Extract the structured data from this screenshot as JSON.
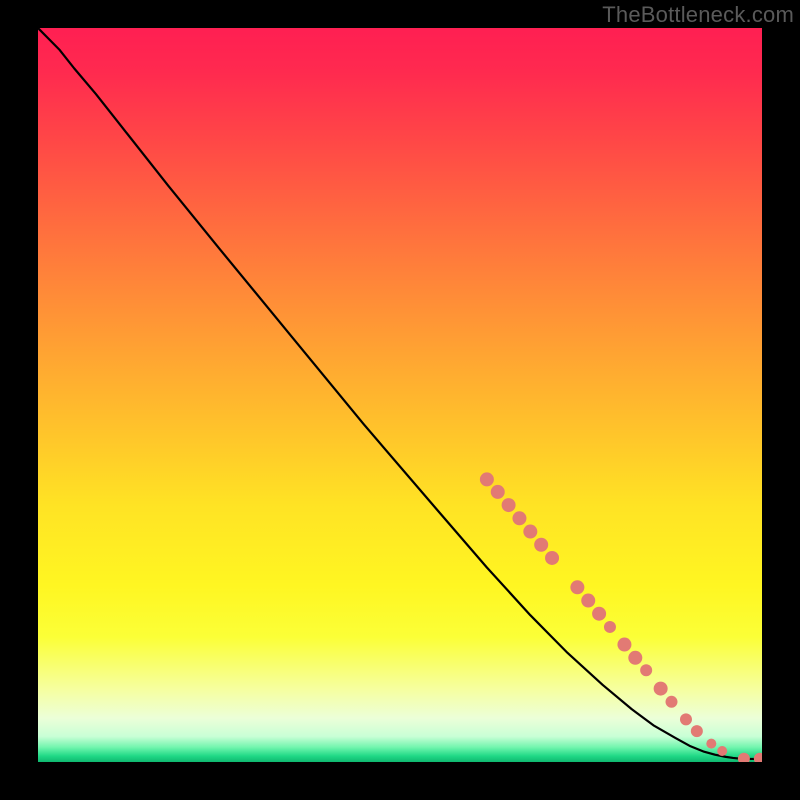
{
  "watermark": "TheBottleneck.com",
  "colors": {
    "frame": "#000000",
    "watermark_text": "#5a5a5a",
    "curve": "#000000",
    "marker_fill": "#e27a74",
    "marker_stroke": "#d46b64",
    "gradient_stops": [
      {
        "offset": 0.0,
        "color": "#ff1f52"
      },
      {
        "offset": 0.06,
        "color": "#ff2a4f"
      },
      {
        "offset": 0.15,
        "color": "#ff4647"
      },
      {
        "offset": 0.26,
        "color": "#ff6a3f"
      },
      {
        "offset": 0.36,
        "color": "#ff8a38"
      },
      {
        "offset": 0.46,
        "color": "#ffa931"
      },
      {
        "offset": 0.56,
        "color": "#ffc72a"
      },
      {
        "offset": 0.65,
        "color": "#ffe324"
      },
      {
        "offset": 0.76,
        "color": "#fff622"
      },
      {
        "offset": 0.83,
        "color": "#fbff37"
      },
      {
        "offset": 0.9,
        "color": "#f6ff9e"
      },
      {
        "offset": 0.94,
        "color": "#ecffd8"
      },
      {
        "offset": 0.965,
        "color": "#c9ffd6"
      },
      {
        "offset": 0.98,
        "color": "#71f5ae"
      },
      {
        "offset": 0.992,
        "color": "#1fd886"
      },
      {
        "offset": 1.0,
        "color": "#0fb86f"
      }
    ]
  },
  "chart_data": {
    "type": "line",
    "title": "",
    "xlabel": "",
    "ylabel": "",
    "xlim": [
      0,
      100
    ],
    "ylim": [
      0,
      100
    ],
    "series": [
      {
        "name": "curve",
        "x": [
          0.0,
          1.5,
          3.0,
          5.0,
          8.0,
          12.0,
          18.0,
          25.0,
          35.0,
          45.0,
          55.0,
          62.0,
          68.0,
          73.0,
          78.0,
          82.0,
          85.0,
          88.0,
          90.0,
          92.0,
          93.5,
          95.0,
          96.0,
          97.0,
          98.0,
          100.0
        ],
        "y": [
          100.0,
          98.5,
          97.0,
          94.5,
          91.0,
          86.0,
          78.5,
          70.0,
          58.0,
          46.0,
          34.5,
          26.5,
          20.0,
          15.0,
          10.5,
          7.2,
          5.0,
          3.3,
          2.2,
          1.4,
          1.0,
          0.7,
          0.55,
          0.45,
          0.42,
          0.42
        ]
      }
    ],
    "markers": [
      {
        "x": 62.0,
        "y": 38.5,
        "r": 7
      },
      {
        "x": 63.5,
        "y": 36.8,
        "r": 7
      },
      {
        "x": 65.0,
        "y": 35.0,
        "r": 7
      },
      {
        "x": 66.5,
        "y": 33.2,
        "r": 7
      },
      {
        "x": 68.0,
        "y": 31.4,
        "r": 7
      },
      {
        "x": 69.5,
        "y": 29.6,
        "r": 7
      },
      {
        "x": 71.0,
        "y": 27.8,
        "r": 7
      },
      {
        "x": 74.5,
        "y": 23.8,
        "r": 7
      },
      {
        "x": 76.0,
        "y": 22.0,
        "r": 7
      },
      {
        "x": 77.5,
        "y": 20.2,
        "r": 7
      },
      {
        "x": 79.0,
        "y": 18.4,
        "r": 6
      },
      {
        "x": 81.0,
        "y": 16.0,
        "r": 7
      },
      {
        "x": 82.5,
        "y": 14.2,
        "r": 7
      },
      {
        "x": 84.0,
        "y": 12.5,
        "r": 6
      },
      {
        "x": 86.0,
        "y": 10.0,
        "r": 7
      },
      {
        "x": 87.5,
        "y": 8.2,
        "r": 6
      },
      {
        "x": 89.5,
        "y": 5.8,
        "r": 6
      },
      {
        "x": 91.0,
        "y": 4.2,
        "r": 6
      },
      {
        "x": 93.0,
        "y": 2.5,
        "r": 5
      },
      {
        "x": 94.5,
        "y": 1.5,
        "r": 5
      },
      {
        "x": 97.5,
        "y": 0.45,
        "r": 6
      },
      {
        "x": 99.7,
        "y": 0.45,
        "r": 6
      }
    ]
  }
}
